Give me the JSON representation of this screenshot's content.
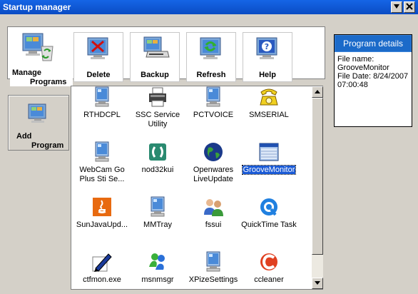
{
  "window": {
    "title": "Startup manager"
  },
  "left": {
    "manage_label_1": "Manage",
    "manage_label_2": "Programs",
    "add_label_1": "Add",
    "add_label_2": "Program"
  },
  "toolbar": {
    "delete": "Delete",
    "backup": "Backup",
    "refresh": "Refresh",
    "help": "Help"
  },
  "programs": [
    {
      "name": "RTHDCPL",
      "icon": "monitor-icon"
    },
    {
      "name": "SSC Service Utility",
      "icon": "printer-icon"
    },
    {
      "name": "PCTVOICE",
      "icon": "monitor-icon"
    },
    {
      "name": "SMSERIAL",
      "icon": "telephone-icon"
    },
    {
      "name": "WebCam Go Plus Sti Se...",
      "icon": "monitor-icon"
    },
    {
      "name": "nod32kui",
      "icon": "nod32-icon"
    },
    {
      "name": "Openwares LiveUpdate",
      "icon": "globe-icon"
    },
    {
      "name": "GrooveMonitor",
      "icon": "window-icon",
      "selected": true
    },
    {
      "name": "SunJavaUpd...",
      "icon": "java-icon"
    },
    {
      "name": "MMTray",
      "icon": "monitor-icon"
    },
    {
      "name": "fssui",
      "icon": "people-icon"
    },
    {
      "name": "QuickTime Task",
      "icon": "quicktime-icon"
    },
    {
      "name": "ctfmon.exe",
      "icon": "pen-icon"
    },
    {
      "name": "msnmsgr",
      "icon": "msn-icon"
    },
    {
      "name": "XPizeSettings",
      "icon": "monitor-icon"
    },
    {
      "name": "ccleaner",
      "icon": "ccleaner-icon"
    }
  ],
  "details": {
    "header": "Program details",
    "line1": "File name:",
    "line2": "GrooveMonitor",
    "line3": "File Date: 8/24/2007",
    "line4": "07:00:48"
  }
}
